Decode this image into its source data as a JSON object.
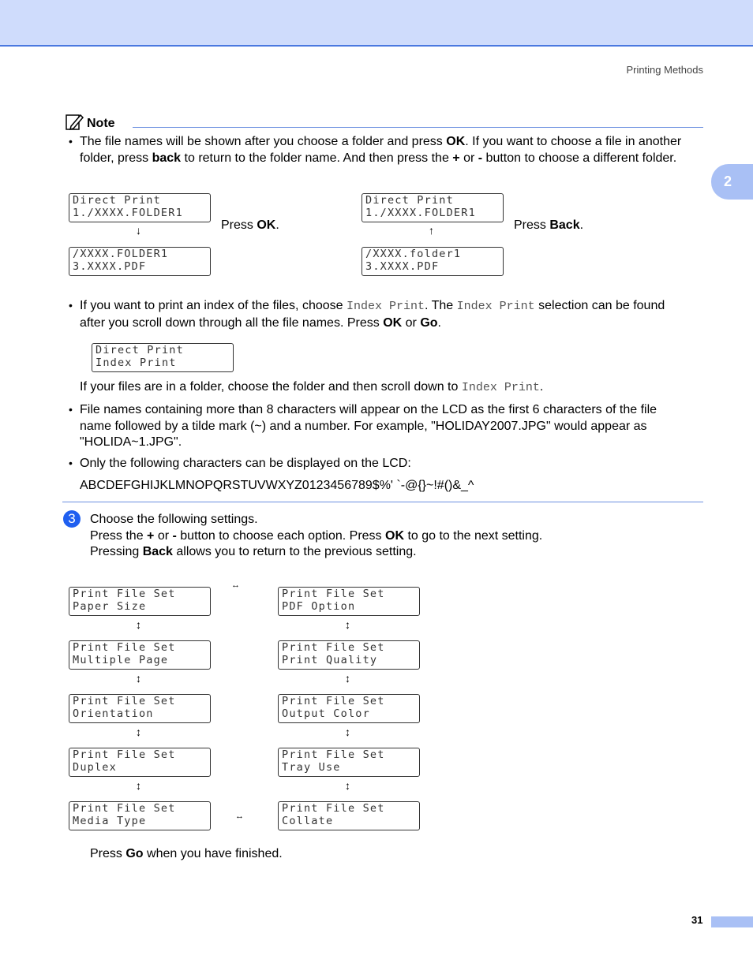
{
  "header": {
    "section": "Printing Methods",
    "chapter": "2",
    "page_number": "31"
  },
  "note": {
    "title": "Note",
    "bullet1": {
      "lines": [
        [
          "The file names will be shown after you choose a folder and press ",
          "OK",
          ". If you want to choose a file in another"
        ],
        [
          "folder, press ",
          "back",
          " to return to the folder name. And then press the ",
          "+",
          " or ",
          "-",
          " button to choose a different folder."
        ]
      ]
    },
    "lcd_top": [
      {
        "line1": "Direct Print",
        "line2": "1./XXXX.FOLDER1"
      },
      {
        "line1": "/XXXX.FOLDER1",
        "line2": "3.XXXX.PDF"
      },
      {
        "line1": "Direct Print",
        "line2": "1./XXXX.FOLDER1"
      },
      {
        "line1": "/XXXX.folder1",
        "line2": "3.XXXX.PDF"
      }
    ],
    "press_ok": [
      "Press ",
      "OK",
      "."
    ],
    "press_back": [
      "Press ",
      "Back",
      "."
    ],
    "arrow_down": "↓",
    "arrow_up": "↑",
    "bullet2": {
      "a": "If you want to print an index of the files, choose ",
      "code1": "Index Print",
      "b": ". The ",
      "code2": "Index Print",
      "c": " selection can be found",
      "line2a": "after you scroll down through all the file names. Press ",
      "ok": "OK",
      "or": " or ",
      "go": "Go",
      "end": "."
    },
    "lcd_index": {
      "line1": "Direct Print",
      "line2": "Index Print"
    },
    "folder_text": {
      "a": "If your files are in a folder, choose the folder and then scroll down to ",
      "code": "Index Print",
      "end": "."
    },
    "bullet3": [
      "File names containing more than 8 characters will appear on the LCD as the first 6 characters of the file",
      "name followed by a tilde mark (~) and a number. For example, \"HOLIDAY2007.JPG\" would appear as",
      "\"HOLIDA~1.JPG\"."
    ],
    "bullet4": "Only the following characters can be displayed on the LCD:",
    "charset": "ABCDEFGHIJKLMNOPQRSTUVWXYZ0123456789$%' `-@{}~!#()&_^"
  },
  "step": {
    "number": "3",
    "line1": "Choose the following settings.",
    "line2": [
      "Press the ",
      "+",
      " or ",
      "-",
      " button to choose each option. Press ",
      "OK",
      " to go to the next setting."
    ],
    "line3": [
      "Pressing ",
      "Back",
      " allows you to return to the previous setting."
    ],
    "left_column": [
      {
        "line1": "Print File Set",
        "line2": "Paper Size"
      },
      {
        "line1": "Print File Set",
        "line2": "Multiple Page"
      },
      {
        "line1": "Print File Set",
        "line2": "Orientation"
      },
      {
        "line1": "Print File Set",
        "line2": "Duplex"
      },
      {
        "line1": "Print File Set",
        "line2": "Media Type"
      }
    ],
    "right_column": [
      {
        "line1": "Print File Set",
        "line2": "PDF Option"
      },
      {
        "line1": "Print File Set",
        "line2": "Print Quality"
      },
      {
        "line1": "Print File Set",
        "line2": "Output Color"
      },
      {
        "line1": "Print File Set",
        "line2": "Tray Use"
      },
      {
        "line1": "Print File Set",
        "line2": "Collate"
      }
    ],
    "arrow_updown": "↕",
    "arrow_leftright": "↔",
    "finish": [
      "Press ",
      "Go",
      " when you have finished."
    ]
  },
  "colors": {
    "band": "#cfdcfc",
    "accent": "#4a78e0",
    "step_circle": "#1f5ff0",
    "chapter_tab": "#a9c0f5"
  }
}
